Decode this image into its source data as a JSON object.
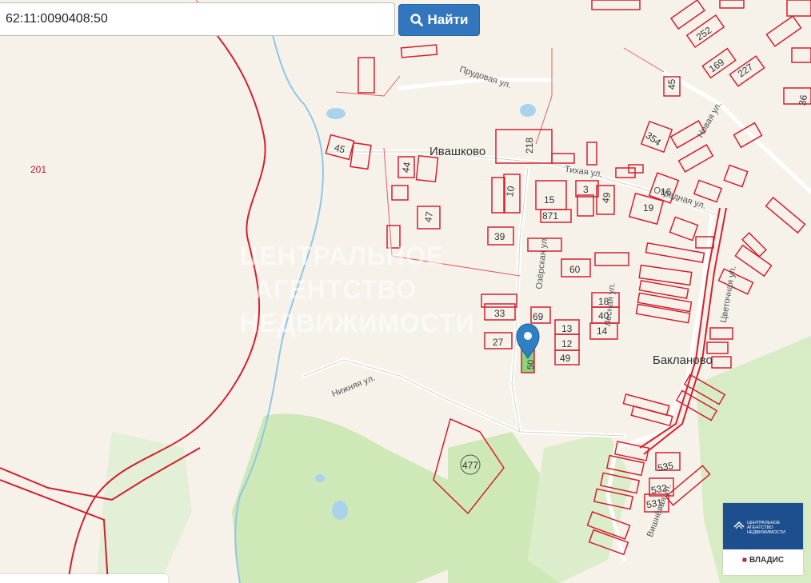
{
  "search": {
    "value": "62:11:0090408:50",
    "button_label": "Найти",
    "icon": "search-icon"
  },
  "map": {
    "settlements": [
      "Ивашково",
      "Бакланово"
    ],
    "streets": [
      "Прудовая ул.",
      "Тихая ул.",
      "Отрадная ул.",
      "Нижняя ул.",
      "Цветочная ул.",
      "Новая ул.",
      "Лесная ул.",
      "Озёрская ул.",
      "Вишнёвая ул."
    ],
    "parcel_labels": [
      "201",
      "45",
      "44",
      "47",
      "10",
      "218",
      "39",
      "15",
      "871",
      "3",
      "49",
      "16",
      "19",
      "354",
      "45",
      "252",
      "169",
      "227",
      "36",
      "60",
      "18",
      "40",
      "14",
      "13",
      "12",
      "49",
      "33",
      "69",
      "27",
      "477",
      "535",
      "532",
      "531",
      "50"
    ],
    "marker": {
      "label": "50",
      "icon": "map-pin-icon",
      "color": "#2f7fc4"
    },
    "colors": {
      "parcel_border": "#d3202f",
      "selected_parcel": "#8fd27e",
      "forest": "#c9e6b3",
      "water": "#a9d3ea",
      "road": "#ffffff"
    }
  },
  "watermark": {
    "line1": "ЦЕНТРАЛЬНОЕ",
    "line2": "АГЕНТСТВО",
    "line3": "НЕДВИЖИМОСТИ"
  },
  "logo": {
    "text": "ЦЕНТРАЛЬНОЕ АГЕНТСТВО НЕДВИЖИМОСТИ",
    "brand": "ВЛАДИС"
  }
}
